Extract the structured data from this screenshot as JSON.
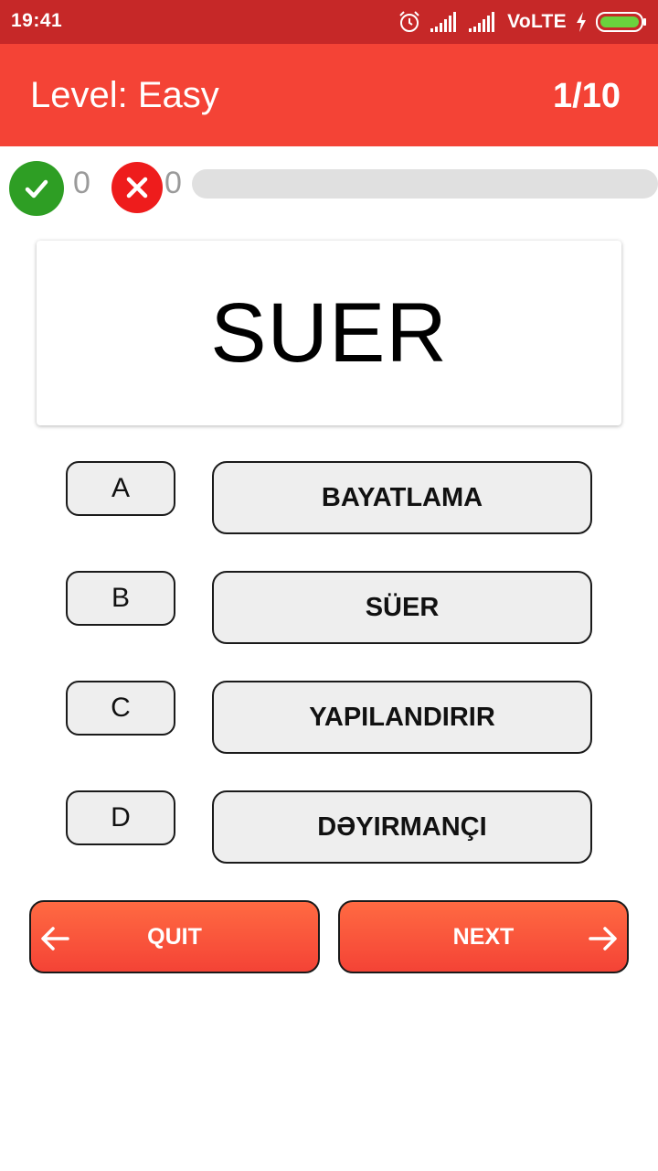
{
  "status_bar": {
    "time": "19:41",
    "network_label": "VoLTE",
    "icons": [
      "alarm-icon",
      "signal-icon",
      "signal-icon",
      "charging-icon",
      "battery-icon"
    ]
  },
  "header": {
    "title": "Level: Easy",
    "question_counter": "1/10"
  },
  "score": {
    "correct_count": "0",
    "wrong_count": "0",
    "progress_fraction": 0,
    "correct_color": "#2e9e24",
    "wrong_color": "#ee1c1c"
  },
  "question": {
    "word": "SUER"
  },
  "options": [
    {
      "letter": "A",
      "answer": "BAYATLAMA"
    },
    {
      "letter": "B",
      "answer": "SÜER"
    },
    {
      "letter": "C",
      "answer": "YAPILANDIRIR"
    },
    {
      "letter": "D",
      "answer": "DƏYIRMANÇI"
    }
  ],
  "buttons": {
    "quit_label": "QUIT",
    "next_label": "NEXT"
  },
  "colors": {
    "status_bar": "#c62828",
    "app_bar": "#f44336",
    "button_gradient_top": "#ff6a42",
    "button_gradient_bottom": "#f44336"
  }
}
